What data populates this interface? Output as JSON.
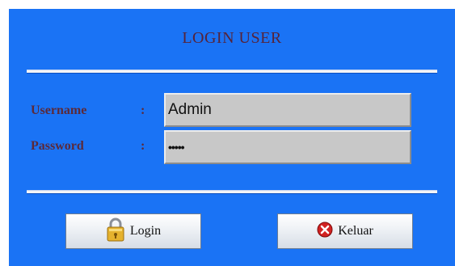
{
  "title": "LOGIN USER",
  "form": {
    "username_label": "Username",
    "password_label": "Password",
    "colon": ":",
    "username_value": "Admin",
    "password_value": "•••••"
  },
  "buttons": {
    "login_label": "Login",
    "login_icon": "padlock-icon",
    "keluar_label": "Keluar",
    "keluar_icon": "close-icon"
  },
  "colors": {
    "panel_bg": "#1a73f5",
    "label_text": "#5b2a3a",
    "field_bg": "#c8c8c8"
  }
}
